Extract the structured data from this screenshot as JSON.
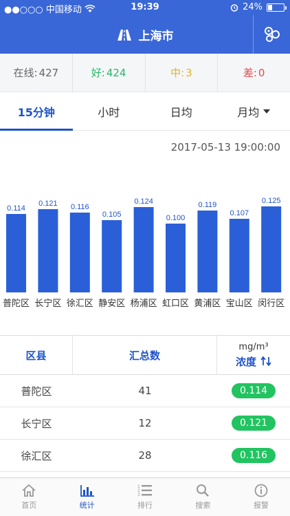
{
  "status": {
    "carrier": "●●○○○ 中国移动",
    "time": "19:39",
    "battery": "24%",
    "battery_level": 0.24
  },
  "nav": {
    "title": "上海市"
  },
  "summary": {
    "online_label": "在线:",
    "online_value": "427",
    "good_label": "好:",
    "good_value": "424",
    "mid_label": "中:",
    "mid_value": "3",
    "bad_label": "差:",
    "bad_value": "0",
    "colors": {
      "good": "#25b767",
      "mid": "#e6b31e",
      "bad": "#e24a4a"
    }
  },
  "tabs": [
    "15分钟",
    "小时",
    "日均",
    "月均"
  ],
  "timestamp": "2017-05-13 19:00:00",
  "chart_data": {
    "type": "bar",
    "categories": [
      "普陀区",
      "长宁区",
      "徐汇区",
      "静安区",
      "杨浦区",
      "虹口区",
      "黄浦区",
      "宝山区",
      "闵行区"
    ],
    "values": [
      0.114,
      0.121,
      0.116,
      0.105,
      0.124,
      0.1,
      0.119,
      0.107,
      0.125
    ],
    "value_labels": [
      "0.114",
      "0.121",
      "0.116",
      "0.105",
      "0.124",
      "0.100",
      "0.119",
      "0.107",
      "0.125"
    ],
    "title": "",
    "xlabel": "",
    "ylabel": "",
    "ylim": [
      0,
      0.14
    ],
    "color": "#2a5fd8",
    "grid": false
  },
  "table": {
    "headers": {
      "district": "区县",
      "count": "汇总数",
      "unit": "mg/m³",
      "concentration": "浓度"
    },
    "rows": [
      {
        "district": "普陀区",
        "count": "41",
        "value": "0.114"
      },
      {
        "district": "长宁区",
        "count": "12",
        "value": "0.121"
      },
      {
        "district": "徐汇区",
        "count": "28",
        "value": "0.116"
      }
    ]
  },
  "tabbar": [
    {
      "label": "首页",
      "icon": "home-icon"
    },
    {
      "label": "统计",
      "icon": "bar-chart-icon"
    },
    {
      "label": "排行",
      "icon": "ranking-list-icon"
    },
    {
      "label": "搜索",
      "icon": "search-icon"
    },
    {
      "label": "报警",
      "icon": "alert-info-icon"
    }
  ]
}
